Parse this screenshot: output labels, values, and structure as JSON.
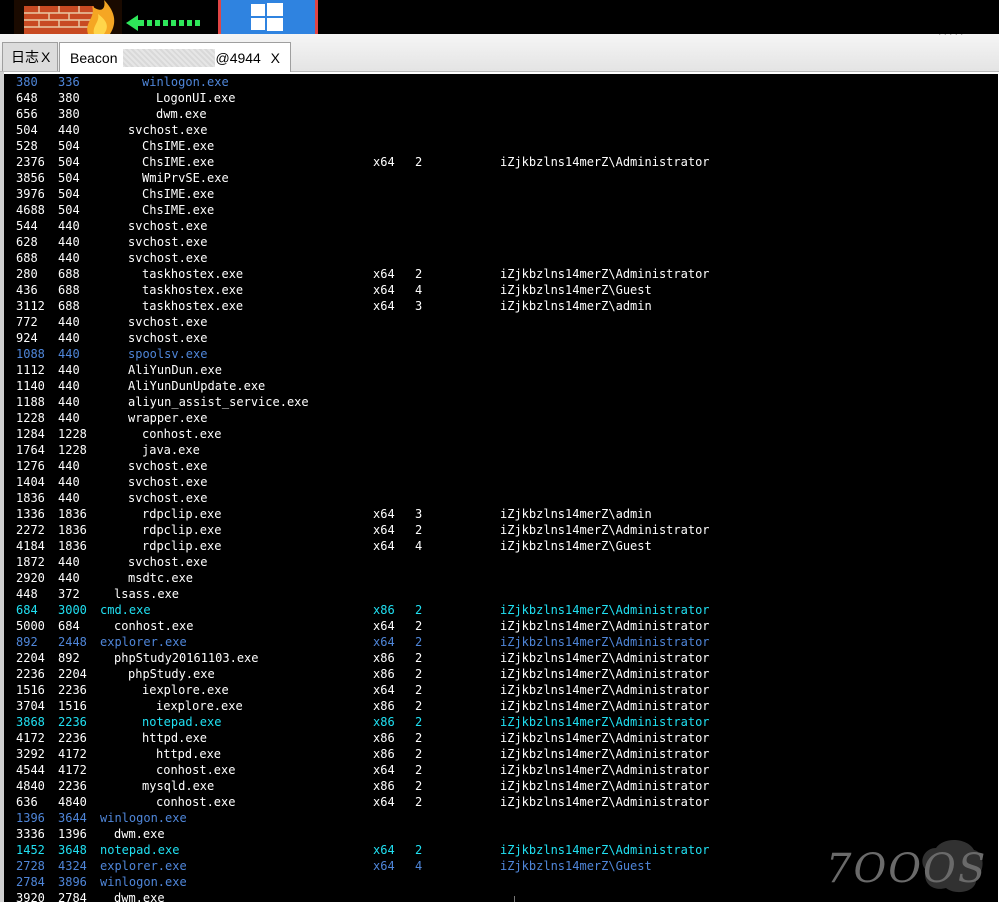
{
  "tabs": [
    {
      "label": "日志",
      "close": "X"
    },
    {
      "label": "Beacon",
      "suffix": "@4944",
      "close": "X"
    }
  ],
  "colors": {
    "default": "#ffffff",
    "blue": "#4f86d9",
    "cyan": "#20e0f2",
    "background": "#000000"
  },
  "processes": [
    {
      "pid": "380",
      "ppid": "336",
      "depth": 3,
      "name": "winlogon.exe",
      "arch": "",
      "session": "",
      "user": "",
      "color": "blue"
    },
    {
      "pid": "648",
      "ppid": "380",
      "depth": 4,
      "name": "LogonUI.exe",
      "arch": "",
      "session": "",
      "user": "",
      "color": ""
    },
    {
      "pid": "656",
      "ppid": "380",
      "depth": 4,
      "name": "dwm.exe",
      "arch": "",
      "session": "",
      "user": "",
      "color": ""
    },
    {
      "pid": "504",
      "ppid": "440",
      "depth": 2,
      "name": "svchost.exe",
      "arch": "",
      "session": "",
      "user": "",
      "color": ""
    },
    {
      "pid": "528",
      "ppid": "504",
      "depth": 3,
      "name": "ChsIME.exe",
      "arch": "",
      "session": "",
      "user": "",
      "color": ""
    },
    {
      "pid": "2376",
      "ppid": "504",
      "depth": 3,
      "name": "ChsIME.exe",
      "arch": "x64",
      "session": "2",
      "user": "iZjkbzlns14merZ\\Administrator",
      "color": ""
    },
    {
      "pid": "3856",
      "ppid": "504",
      "depth": 3,
      "name": "WmiPrvSE.exe",
      "arch": "",
      "session": "",
      "user": "",
      "color": ""
    },
    {
      "pid": "3976",
      "ppid": "504",
      "depth": 3,
      "name": "ChsIME.exe",
      "arch": "",
      "session": "",
      "user": "",
      "color": ""
    },
    {
      "pid": "4688",
      "ppid": "504",
      "depth": 3,
      "name": "ChsIME.exe",
      "arch": "",
      "session": "",
      "user": "",
      "color": ""
    },
    {
      "pid": "544",
      "ppid": "440",
      "depth": 2,
      "name": "svchost.exe",
      "arch": "",
      "session": "",
      "user": "",
      "color": ""
    },
    {
      "pid": "628",
      "ppid": "440",
      "depth": 2,
      "name": "svchost.exe",
      "arch": "",
      "session": "",
      "user": "",
      "color": ""
    },
    {
      "pid": "688",
      "ppid": "440",
      "depth": 2,
      "name": "svchost.exe",
      "arch": "",
      "session": "",
      "user": "",
      "color": ""
    },
    {
      "pid": "280",
      "ppid": "688",
      "depth": 3,
      "name": "taskhostex.exe",
      "arch": "x64",
      "session": "2",
      "user": "iZjkbzlns14merZ\\Administrator",
      "color": ""
    },
    {
      "pid": "436",
      "ppid": "688",
      "depth": 3,
      "name": "taskhostex.exe",
      "arch": "x64",
      "session": "4",
      "user": "iZjkbzlns14merZ\\Guest",
      "color": ""
    },
    {
      "pid": "3112",
      "ppid": "688",
      "depth": 3,
      "name": "taskhostex.exe",
      "arch": "x64",
      "session": "3",
      "user": "iZjkbzlns14merZ\\admin",
      "color": ""
    },
    {
      "pid": "772",
      "ppid": "440",
      "depth": 2,
      "name": "svchost.exe",
      "arch": "",
      "session": "",
      "user": "",
      "color": ""
    },
    {
      "pid": "924",
      "ppid": "440",
      "depth": 2,
      "name": "svchost.exe",
      "arch": "",
      "session": "",
      "user": "",
      "color": ""
    },
    {
      "pid": "1088",
      "ppid": "440",
      "depth": 2,
      "name": "spoolsv.exe",
      "arch": "",
      "session": "",
      "user": "",
      "color": "blue"
    },
    {
      "pid": "1112",
      "ppid": "440",
      "depth": 2,
      "name": "AliYunDun.exe",
      "arch": "",
      "session": "",
      "user": "",
      "color": ""
    },
    {
      "pid": "1140",
      "ppid": "440",
      "depth": 2,
      "name": "AliYunDunUpdate.exe",
      "arch": "",
      "session": "",
      "user": "",
      "color": ""
    },
    {
      "pid": "1188",
      "ppid": "440",
      "depth": 2,
      "name": "aliyun_assist_service.exe",
      "arch": "",
      "session": "",
      "user": "",
      "color": ""
    },
    {
      "pid": "1228",
      "ppid": "440",
      "depth": 2,
      "name": "wrapper.exe",
      "arch": "",
      "session": "",
      "user": "",
      "color": ""
    },
    {
      "pid": "1284",
      "ppid": "1228",
      "depth": 3,
      "name": "conhost.exe",
      "arch": "",
      "session": "",
      "user": "",
      "color": ""
    },
    {
      "pid": "1764",
      "ppid": "1228",
      "depth": 3,
      "name": "java.exe",
      "arch": "",
      "session": "",
      "user": "",
      "color": ""
    },
    {
      "pid": "1276",
      "ppid": "440",
      "depth": 2,
      "name": "svchost.exe",
      "arch": "",
      "session": "",
      "user": "",
      "color": ""
    },
    {
      "pid": "1404",
      "ppid": "440",
      "depth": 2,
      "name": "svchost.exe",
      "arch": "",
      "session": "",
      "user": "",
      "color": ""
    },
    {
      "pid": "1836",
      "ppid": "440",
      "depth": 2,
      "name": "svchost.exe",
      "arch": "",
      "session": "",
      "user": "",
      "color": ""
    },
    {
      "pid": "1336",
      "ppid": "1836",
      "depth": 3,
      "name": "rdpclip.exe",
      "arch": "x64",
      "session": "3",
      "user": "iZjkbzlns14merZ\\admin",
      "color": ""
    },
    {
      "pid": "2272",
      "ppid": "1836",
      "depth": 3,
      "name": "rdpclip.exe",
      "arch": "x64",
      "session": "2",
      "user": "iZjkbzlns14merZ\\Administrator",
      "color": ""
    },
    {
      "pid": "4184",
      "ppid": "1836",
      "depth": 3,
      "name": "rdpclip.exe",
      "arch": "x64",
      "session": "4",
      "user": "iZjkbzlns14merZ\\Guest",
      "color": ""
    },
    {
      "pid": "1872",
      "ppid": "440",
      "depth": 2,
      "name": "svchost.exe",
      "arch": "",
      "session": "",
      "user": "",
      "color": ""
    },
    {
      "pid": "2920",
      "ppid": "440",
      "depth": 2,
      "name": "msdtc.exe",
      "arch": "",
      "session": "",
      "user": "",
      "color": ""
    },
    {
      "pid": "448",
      "ppid": "372",
      "depth": 1,
      "name": "lsass.exe",
      "arch": "",
      "session": "",
      "user": "",
      "color": ""
    },
    {
      "pid": "684",
      "ppid": "3000",
      "depth": 0,
      "name": "cmd.exe",
      "arch": "x86",
      "session": "2",
      "user": "iZjkbzlns14merZ\\Administrator",
      "color": "cyan"
    },
    {
      "pid": "5000",
      "ppid": "684",
      "depth": 1,
      "name": "conhost.exe",
      "arch": "x64",
      "session": "2",
      "user": "iZjkbzlns14merZ\\Administrator",
      "color": ""
    },
    {
      "pid": "892",
      "ppid": "2448",
      "depth": 0,
      "name": "explorer.exe",
      "arch": "x64",
      "session": "2",
      "user": "iZjkbzlns14merZ\\Administrator",
      "color": "blue"
    },
    {
      "pid": "2204",
      "ppid": "892",
      "depth": 1,
      "name": "phpStudy20161103.exe",
      "arch": "x86",
      "session": "2",
      "user": "iZjkbzlns14merZ\\Administrator",
      "color": ""
    },
    {
      "pid": "2236",
      "ppid": "2204",
      "depth": 2,
      "name": "phpStudy.exe",
      "arch": "x86",
      "session": "2",
      "user": "iZjkbzlns14merZ\\Administrator",
      "color": ""
    },
    {
      "pid": "1516",
      "ppid": "2236",
      "depth": 3,
      "name": "iexplore.exe",
      "arch": "x64",
      "session": "2",
      "user": "iZjkbzlns14merZ\\Administrator",
      "color": ""
    },
    {
      "pid": "3704",
      "ppid": "1516",
      "depth": 4,
      "name": "iexplore.exe",
      "arch": "x86",
      "session": "2",
      "user": "iZjkbzlns14merZ\\Administrator",
      "color": ""
    },
    {
      "pid": "3868",
      "ppid": "2236",
      "depth": 3,
      "name": "notepad.exe",
      "arch": "x86",
      "session": "2",
      "user": "iZjkbzlns14merZ\\Administrator",
      "color": "cyan"
    },
    {
      "pid": "4172",
      "ppid": "2236",
      "depth": 3,
      "name": "httpd.exe",
      "arch": "x86",
      "session": "2",
      "user": "iZjkbzlns14merZ\\Administrator",
      "color": ""
    },
    {
      "pid": "3292",
      "ppid": "4172",
      "depth": 4,
      "name": "httpd.exe",
      "arch": "x86",
      "session": "2",
      "user": "iZjkbzlns14merZ\\Administrator",
      "color": ""
    },
    {
      "pid": "4544",
      "ppid": "4172",
      "depth": 4,
      "name": "conhost.exe",
      "arch": "x64",
      "session": "2",
      "user": "iZjkbzlns14merZ\\Administrator",
      "color": ""
    },
    {
      "pid": "4840",
      "ppid": "2236",
      "depth": 3,
      "name": "mysqld.exe",
      "arch": "x86",
      "session": "2",
      "user": "iZjkbzlns14merZ\\Administrator",
      "color": ""
    },
    {
      "pid": "636",
      "ppid": "4840",
      "depth": 4,
      "name": "conhost.exe",
      "arch": "x64",
      "session": "2",
      "user": "iZjkbzlns14merZ\\Administrator",
      "color": ""
    },
    {
      "pid": "1396",
      "ppid": "3644",
      "depth": 0,
      "name": "winlogon.exe",
      "arch": "",
      "session": "",
      "user": "",
      "color": "blue"
    },
    {
      "pid": "3336",
      "ppid": "1396",
      "depth": 1,
      "name": "dwm.exe",
      "arch": "",
      "session": "",
      "user": "",
      "color": ""
    },
    {
      "pid": "1452",
      "ppid": "3648",
      "depth": 0,
      "name": "notepad.exe",
      "arch": "x64",
      "session": "2",
      "user": "iZjkbzlns14merZ\\Administrator",
      "color": "cyan"
    },
    {
      "pid": "2728",
      "ppid": "4324",
      "depth": 0,
      "name": "explorer.exe",
      "arch": "x64",
      "session": "4",
      "user": "iZjkbzlns14merZ\\Guest",
      "color": "blue"
    },
    {
      "pid": "2784",
      "ppid": "3896",
      "depth": 0,
      "name": "winlogon.exe",
      "arch": "",
      "session": "",
      "user": "",
      "color": "blue"
    },
    {
      "pid": "3920",
      "ppid": "2784",
      "depth": 1,
      "name": "dwm.exe",
      "arch": "",
      "session": "",
      "user": "",
      "color": ""
    }
  ],
  "watermark": "7OOOS"
}
